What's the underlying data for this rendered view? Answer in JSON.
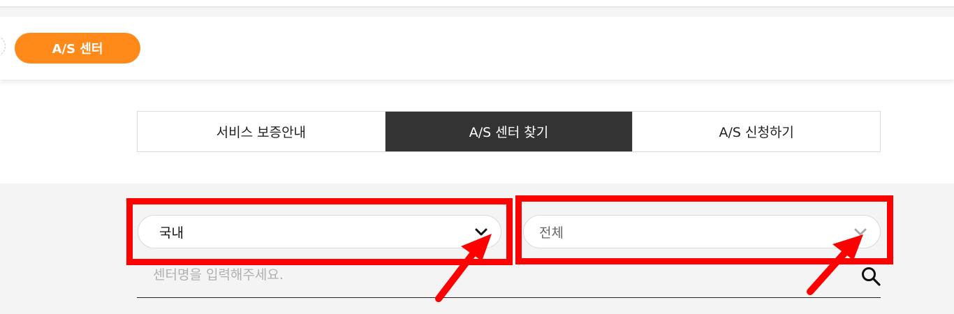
{
  "breadcrumb": {
    "current": "A/S 센터"
  },
  "tabs": [
    {
      "label": "서비스 보증안내",
      "active": false
    },
    {
      "label": "A/S 센터 찾기",
      "active": true
    },
    {
      "label": "A/S 신청하기",
      "active": false
    }
  ],
  "search": {
    "country_select": {
      "value": "국내"
    },
    "region_select": {
      "value": "전체"
    },
    "name_input": {
      "placeholder": "센터명을 입력해주세요."
    }
  },
  "icons": {
    "country_chevron": "chevron-down-icon",
    "region_chevron": "chevron-down-icon",
    "search": "search-icon"
  },
  "colors": {
    "accent": "#ff8a1a",
    "active_tab": "#333333",
    "annotation": "#ff0000"
  }
}
